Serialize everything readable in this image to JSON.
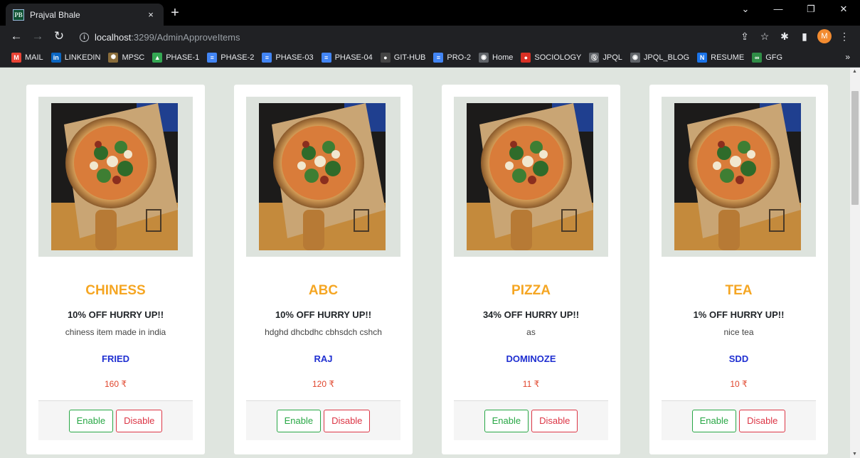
{
  "browser": {
    "tab_title": "Prajval Bhale",
    "tab_favicon": "PB",
    "close_glyph": "×",
    "new_tab_glyph": "+",
    "url_host": "localhost",
    "url_rest": ":3299/AdminApproveItems",
    "avatar_letter": "M",
    "bookmarks_more": "»",
    "bookmarks": [
      {
        "label": "MAIL",
        "icon": "gmail-icon",
        "color": "#ea4335",
        "glyph": "M"
      },
      {
        "label": "LINKEDIN",
        "icon": "linkedin-icon",
        "color": "#0a66c2",
        "glyph": "in"
      },
      {
        "label": "MPSC",
        "icon": "mpsc-icon",
        "color": "#8a6d3b",
        "glyph": "✺"
      },
      {
        "label": "PHASE-1",
        "icon": "drive-icon",
        "color": "#34a853",
        "glyph": "▲"
      },
      {
        "label": "PHASE-2",
        "icon": "docs-icon",
        "color": "#4285f4",
        "glyph": "≡"
      },
      {
        "label": "PHASE-03",
        "icon": "docs-icon",
        "color": "#4285f4",
        "glyph": "≡"
      },
      {
        "label": "PHASE-04",
        "icon": "docs-icon",
        "color": "#4285f4",
        "glyph": "≡"
      },
      {
        "label": "GIT-HUB",
        "icon": "github-icon",
        "color": "#444444",
        "glyph": "●"
      },
      {
        "label": "PRO-2",
        "icon": "docs-icon",
        "color": "#4285f4",
        "glyph": "≡"
      },
      {
        "label": "Home",
        "icon": "globe-icon",
        "color": "#5f6368",
        "glyph": "◉"
      },
      {
        "label": "SOCIOLOGY",
        "icon": "sociology-icon",
        "color": "#d93025",
        "glyph": "●"
      },
      {
        "label": "JPQL",
        "icon": "jpql-icon",
        "color": "#5f6368",
        "glyph": "Ⓠ"
      },
      {
        "label": "JPQL_BLOG",
        "icon": "globe-icon",
        "color": "#5f6368",
        "glyph": "◉"
      },
      {
        "label": "RESUME",
        "icon": "resume-icon",
        "color": "#1a73e8",
        "glyph": "N"
      },
      {
        "label": "GFG",
        "icon": "gfg-icon",
        "color": "#2f8d46",
        "glyph": "∞"
      }
    ]
  },
  "items": [
    {
      "name": "CHINESS",
      "offer": "10% OFF HURRY UP!!",
      "description": "chiness item made in india",
      "brand": "FRIED",
      "price": "160 ₹",
      "enable_label": "Enable",
      "disable_label": "Disable"
    },
    {
      "name": "ABC",
      "offer": "10% OFF HURRY UP!!",
      "description": "hdghd dhcbdhc cbhsdch cshch",
      "brand": "RAJ",
      "price": "120 ₹",
      "enable_label": "Enable",
      "disable_label": "Disable"
    },
    {
      "name": "PIZZA",
      "offer": "34% OFF HURRY UP!!",
      "description": "as",
      "brand": "DOMINOZE",
      "price": "11 ₹",
      "enable_label": "Enable",
      "disable_label": "Disable"
    },
    {
      "name": "TEA",
      "offer": "1% OFF HURRY UP!!",
      "description": "nice tea",
      "brand": "SDD",
      "price": "10 ₹",
      "enable_label": "Enable",
      "disable_label": "Disable"
    }
  ],
  "colors": {
    "item_name": "#f5a623",
    "brand": "#1f2fd1",
    "price": "#e0452c",
    "enable": "#28a745",
    "disable": "#dc3545",
    "page_bg": "#dfe5df"
  }
}
